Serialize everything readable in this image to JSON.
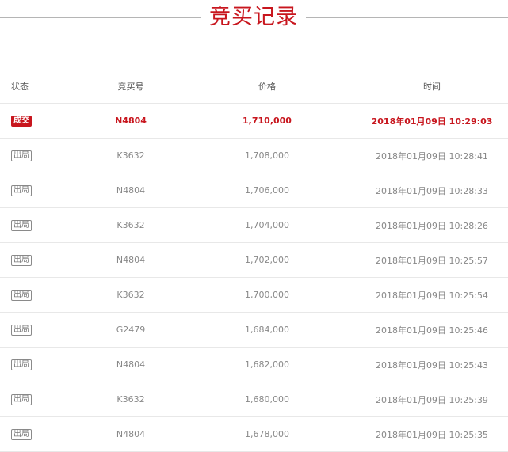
{
  "page": {
    "title": "竞买记录"
  },
  "table": {
    "headers": {
      "status": "状态",
      "number": "竞买号",
      "price": "价格",
      "time": "时间"
    },
    "rows": [
      {
        "status": "成交",
        "number": "N4804",
        "price": "1,710,000",
        "time": "2018年01月09日 10:29:03"
      },
      {
        "status": "出局",
        "number": "K3632",
        "price": "1,708,000",
        "time": "2018年01月09日 10:28:41"
      },
      {
        "status": "出局",
        "number": "N4804",
        "price": "1,706,000",
        "time": "2018年01月09日 10:28:33"
      },
      {
        "status": "出局",
        "number": "K3632",
        "price": "1,704,000",
        "time": "2018年01月09日 10:28:26"
      },
      {
        "status": "出局",
        "number": "N4804",
        "price": "1,702,000",
        "time": "2018年01月09日 10:25:57"
      },
      {
        "status": "出局",
        "number": "K3632",
        "price": "1,700,000",
        "time": "2018年01月09日 10:25:54"
      },
      {
        "status": "出局",
        "number": "G2479",
        "price": "1,684,000",
        "time": "2018年01月09日 10:25:46"
      },
      {
        "status": "出局",
        "number": "N4804",
        "price": "1,682,000",
        "time": "2018年01月09日 10:25:43"
      },
      {
        "status": "出局",
        "number": "K3632",
        "price": "1,680,000",
        "time": "2018年01月09日 10:25:39"
      },
      {
        "status": "出局",
        "number": "N4804",
        "price": "1,678,000",
        "time": "2018年01月09日 10:25:35"
      }
    ]
  },
  "colors": {
    "accent": "#c8161e",
    "text": "#888888",
    "divider": "#e8e8e8"
  }
}
